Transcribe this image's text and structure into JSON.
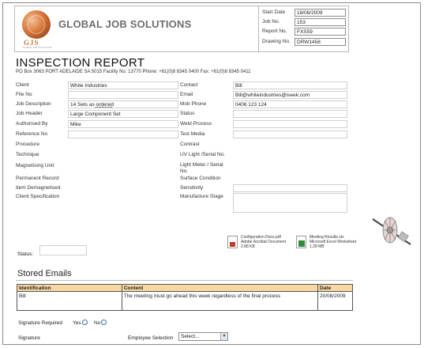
{
  "header": {
    "company": "GLOBAL JOB SOLUTIONS",
    "logo_text": "GJS",
    "logo_subtext": "GLOBAL JOB SOLUTIONS",
    "meta": [
      {
        "label": "Start Date",
        "value": "18/08/2009"
      },
      {
        "label": "Job No.",
        "value": "153"
      },
      {
        "label": "Report No.",
        "value": "FXS59"
      },
      {
        "label": "Drawing No.",
        "value": "DRW1458"
      }
    ]
  },
  "report": {
    "title": "INSPECTION REPORT",
    "address": "PO Box 3063 PORT ADELAIDE SA 5015 Facility No. 13770 Phone: +61(0)8 8345 0400 Fax: +61(0)8 8345 0411"
  },
  "left_fields": [
    {
      "label": "Client",
      "value": "White Industries"
    },
    {
      "label": "File No",
      "value": ""
    },
    {
      "label": "Job Description",
      "value": "14 Sets as ",
      "value_emph": "ordered"
    },
    {
      "label": "Job Header",
      "value": "Large Component Set"
    },
    {
      "label": "Authorised By",
      "value": "Mike"
    },
    {
      "label": "Reference No",
      "value": ""
    },
    {
      "label": "Procedure",
      "value": ""
    },
    {
      "label": "Technique",
      "value": ""
    },
    {
      "label": "Magnetising Unit",
      "value": ""
    },
    {
      "label": "Permanent Record",
      "value": ""
    },
    {
      "label": "Item Demagnetised",
      "value": ""
    },
    {
      "label": "Client Specification",
      "value": ""
    }
  ],
  "right_fields": [
    {
      "label": "Contact",
      "value": "Bill"
    },
    {
      "label": "Email",
      "value": "Bill@whiteindustries@iseek.com"
    },
    {
      "label": "Mob Phone",
      "value": "0406 123 124"
    },
    {
      "label": "Status",
      "value": ""
    },
    {
      "label": "Weld Process",
      "value": ""
    },
    {
      "label": "Test Media",
      "value": ""
    },
    {
      "label": "Contrast",
      "value": ""
    },
    {
      "label": "UV Light /Serial No.",
      "value": ""
    },
    {
      "label": "Light Meter / Serial No.",
      "value": ""
    },
    {
      "label": "Surface Condition",
      "value": ""
    },
    {
      "label": "Sensitivity",
      "value": ""
    },
    {
      "label": "Manufacture Stage",
      "value": ""
    }
  ],
  "attachments": [
    {
      "name": "Configuration Docs.pdf",
      "type": "Adobe Acrobat Document",
      "size": "2.88 KB",
      "icon": "pdf-file-icon"
    },
    {
      "name": "Meeting Results.xls",
      "type": "Microsoft Excel Worksheet",
      "size": "1.28 MB",
      "icon": "excel-file-icon"
    }
  ],
  "status_label": "Status:",
  "stored_emails": {
    "heading": "Stored Emails",
    "columns": [
      "Identification",
      "Content",
      "Date"
    ],
    "rows": [
      [
        "Bill",
        "The meeting must go ahead this week regardless of the final process",
        "20/08/2009"
      ]
    ]
  },
  "signature": {
    "required_label": "Signature Required",
    "yes_label": "Yes",
    "no_label": "No",
    "signature_label": "Signature",
    "employee_label": "Employee Selection",
    "employee_selected": "Select..."
  },
  "colors": {
    "table_header_bg": "#f7d8a2",
    "logo_orange": "#d07a3a",
    "company_grey": "#6d6d6d"
  }
}
